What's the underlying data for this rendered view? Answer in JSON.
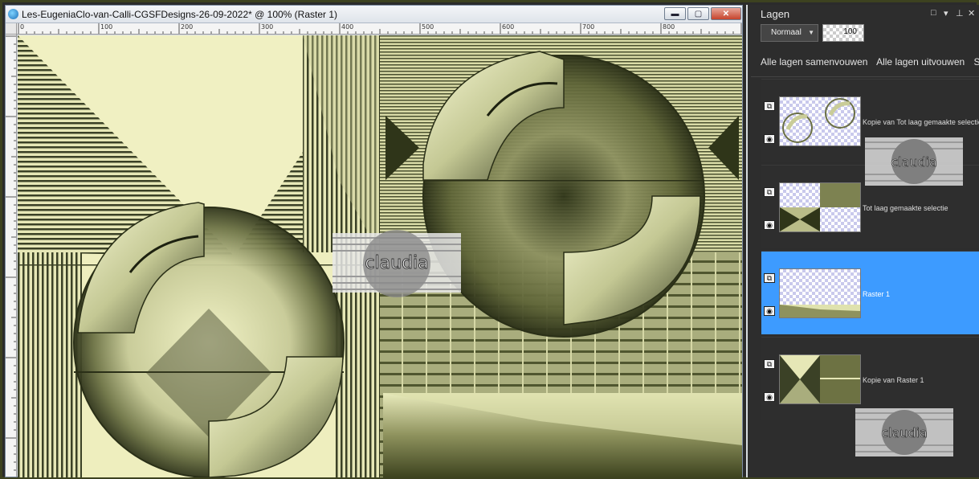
{
  "document": {
    "title": "Les-EugeniaClo-van-Calli-CGSFDesigns-26-09-2022* @ 100% (Raster 1)",
    "window_buttons": {
      "minimize": "▬",
      "maximize": "▢",
      "close": "✕"
    },
    "ruler_labels": [
      "0",
      "100",
      "200",
      "300",
      "400",
      "500",
      "600",
      "700",
      "800"
    ],
    "watermark": "claudia"
  },
  "layers_palette": {
    "title": "Lagen",
    "panel_controls": {
      "close": "□",
      "menu": "▾",
      "pin": "⊥",
      "dismiss": "✕"
    },
    "blend_mode": "Normaal",
    "opacity": "100",
    "actions": [
      "Alle lagen samenvouwen",
      "Alle lagen uitvouwen",
      "Sn"
    ],
    "layers": [
      {
        "name": "Kopie van Tot laag gemaakte selectie",
        "selected": false
      },
      {
        "name": "Tot laag gemaakte selectie",
        "selected": false
      },
      {
        "name": "Raster 1",
        "selected": true
      },
      {
        "name": "Kopie van Raster 1",
        "selected": false
      }
    ],
    "watermark": "claudia"
  },
  "colors": {
    "palette_bg": "#2d2d2d",
    "selected_layer": "#3d9bff",
    "canvas_light": "#eeeebe",
    "canvas_dark": "#3b4126"
  }
}
